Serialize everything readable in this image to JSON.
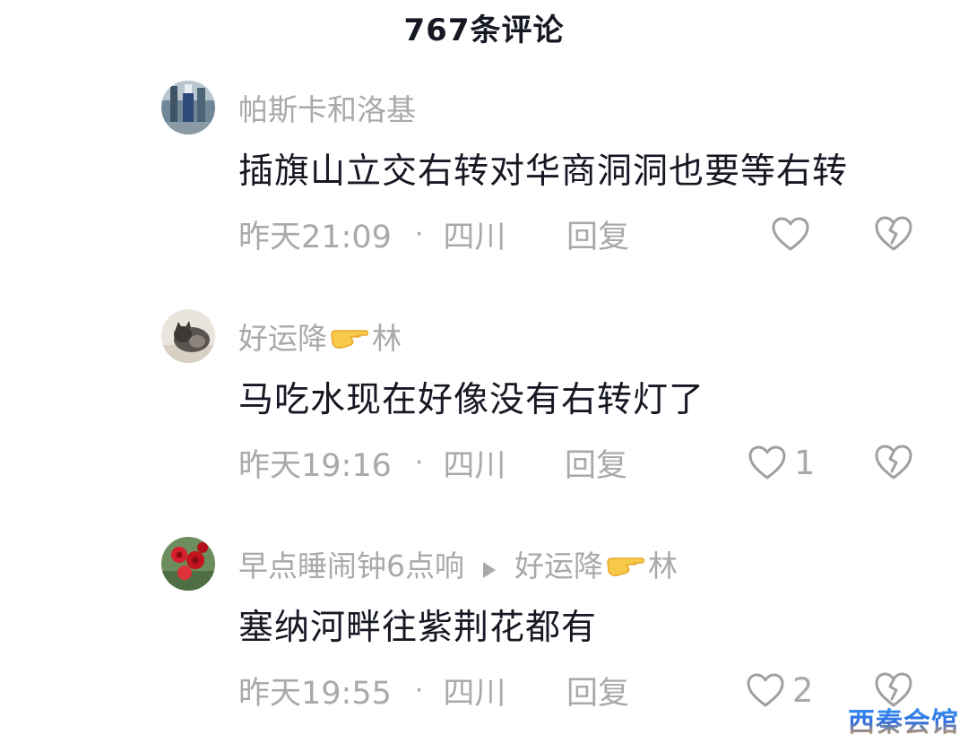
{
  "header": {
    "title": "767条评论"
  },
  "comments": [
    {
      "username": "帕斯卡和洛基",
      "content": "插旗山立交右转对华商洞洞也要等右转",
      "time": "昨天21:09",
      "location": "四川",
      "reply_label": "回复",
      "like_count": "",
      "avatar_icon": "avatar-tower"
    },
    {
      "username_part1": "好运降",
      "username_part2": "林",
      "content": "马吃水现在好像没有右转灯了",
      "time": "昨天19:16",
      "location": "四川",
      "reply_label": "回复",
      "like_count": "1",
      "avatar_icon": "avatar-cat"
    },
    {
      "username": "早点睡闹钟6点响",
      "reply_to_part1": "好运降",
      "reply_to_part2": "林",
      "content": "塞纳河畔往紫荆花都有",
      "time": "昨天19:55",
      "location": "四川",
      "reply_label": "回复",
      "like_count": "2",
      "avatar_icon": "avatar-roses"
    }
  ],
  "separator": "·",
  "watermark": "西秦会馆",
  "colors": {
    "text_primary": "#161823",
    "text_secondary": "#a9a9ad",
    "icon_gray": "#a0a0a4",
    "hand_emoji": "#f7c948"
  }
}
